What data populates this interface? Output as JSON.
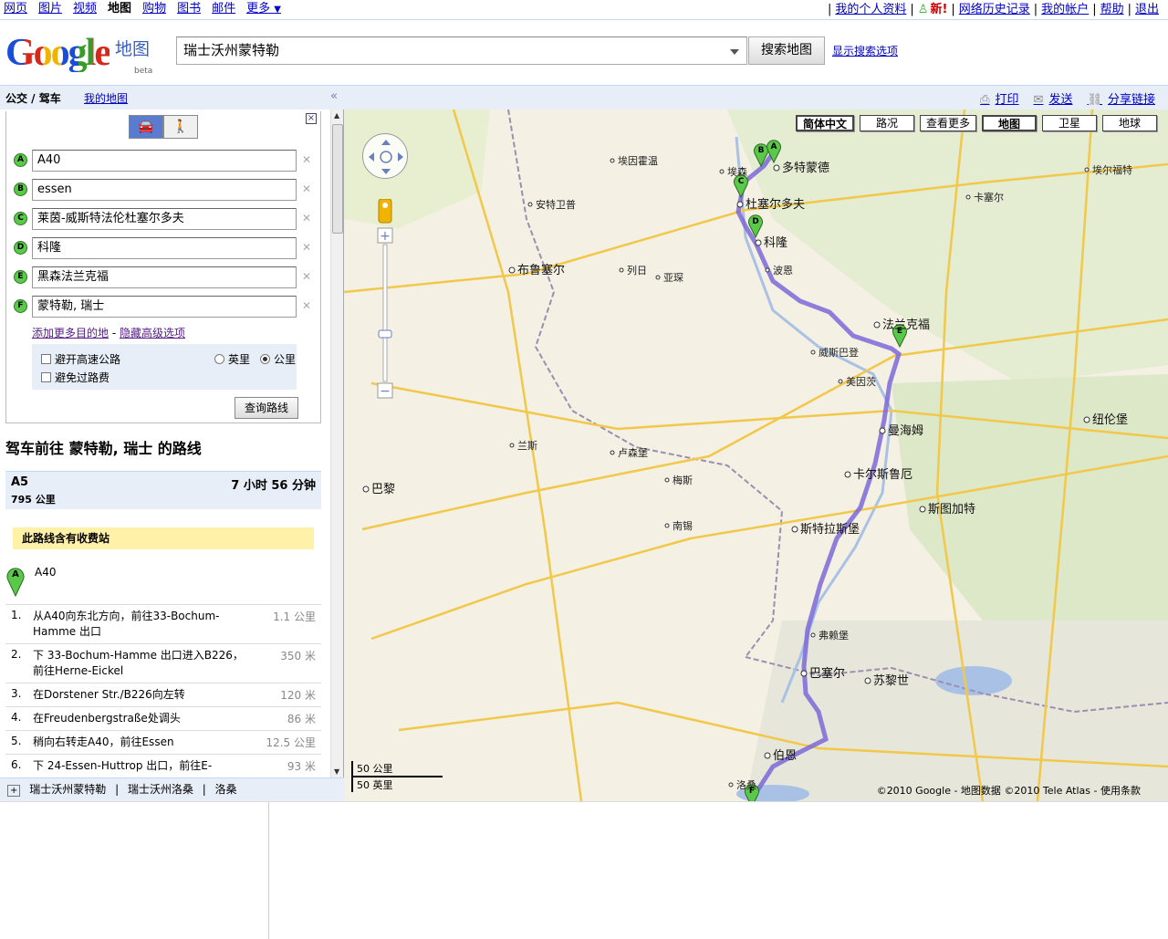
{
  "topnav": {
    "items": [
      "网页",
      "图片",
      "视频",
      "地图",
      "购物",
      "图书",
      "邮件",
      "更多"
    ],
    "current": "地图",
    "more_arrow": "▼",
    "right": {
      "profile": "我的个人资料",
      "new_badge": "新!",
      "history": "网络历史记录",
      "account": "我的帐户",
      "help": "帮助",
      "signout": "退出"
    }
  },
  "header": {
    "logo_google": "Google",
    "logo_maps": "地图",
    "logo_beta": "beta",
    "search_value": "瑞士沃州蒙特勒",
    "search_button": "搜索地图",
    "show_options": "显示搜索选项"
  },
  "toolbar": {
    "tab_directions": "公交 / 驾车",
    "tab_mymaps": "我的地图",
    "collapse": "«",
    "print": "打印",
    "send": "发送",
    "share": "分享链接"
  },
  "directions": {
    "waypoints": [
      {
        "marker": "A",
        "value": "A40"
      },
      {
        "marker": "B",
        "value": "essen"
      },
      {
        "marker": "C",
        "value": "莱茵-威斯特法伦杜塞尔多夫"
      },
      {
        "marker": "D",
        "value": "科隆"
      },
      {
        "marker": "E",
        "value": "黑森法兰克福"
      },
      {
        "marker": "F",
        "value": "蒙特勒, 瑞士"
      }
    ],
    "add_destination": "添加更多目的地",
    "hide_options": "隐藏高级选项",
    "avoid_highways": "避开高速公路",
    "avoid_tolls": "避免过路费",
    "unit_miles": "英里",
    "unit_km": "公里",
    "query_button": "查询路线",
    "route_title": "驾车前往 蒙特勒, 瑞士 的路线",
    "summary_road": "A5",
    "summary_distance": "795 公里",
    "summary_time": "7 小时 56 分钟",
    "toll_notice": "此路线含有收费站",
    "start_label": "A40",
    "steps": [
      {
        "n": "1.",
        "text": "从A40向东北方向，前往33-Bochum-Hamme 出口",
        "dist": "1.1 公里"
      },
      {
        "n": "2.",
        "text": "下 33-Bochum-Hamme 出口进入B226，前往Herne-Eickel",
        "dist": "350 米"
      },
      {
        "n": "3.",
        "text": "在Dorstener Str./B226向左转",
        "dist": "120 米"
      },
      {
        "n": "4.",
        "text": "在Freudenbergstraße处调头",
        "dist": "86 米"
      },
      {
        "n": "5.",
        "text": "稍向右转走A40，前往Essen",
        "dist": "12.5 公里"
      },
      {
        "n": "6.",
        "text": "下 24-Essen-Huttrop 出口，前往E-",
        "dist": "93 米"
      }
    ]
  },
  "bottombar": {
    "links": [
      "瑞士沃州蒙特勒",
      "瑞士沃州洛桑",
      "洛桑"
    ],
    "sep": "|"
  },
  "map": {
    "types": [
      "简体中文",
      "路况",
      "查看更多",
      "地图",
      "卫星",
      "地球"
    ],
    "active_type": "地图",
    "scale_km": "50 公里",
    "scale_mi": "50 英里",
    "copyright": "©2010 Google - 地图数据 ©2010 Tele Atlas - 使用条款",
    "route_color": "#6a5acd",
    "cities": [
      {
        "name": "多特蒙德",
        "big": true
      },
      {
        "name": "杜塞尔多夫",
        "big": true
      },
      {
        "name": "科隆",
        "big": true
      },
      {
        "name": "波恩",
        "big": false
      },
      {
        "name": "法兰克福",
        "big": true
      },
      {
        "name": "曼海姆",
        "big": true
      },
      {
        "name": "卡尔斯鲁厄",
        "big": true
      },
      {
        "name": "斯特拉斯堡",
        "big": true
      },
      {
        "name": "巴塞尔",
        "big": true
      },
      {
        "name": "伯恩",
        "big": true
      },
      {
        "name": "苏黎世",
        "big": true
      },
      {
        "name": "斯图加特",
        "big": true
      },
      {
        "name": "纽伦堡",
        "big": true
      },
      {
        "name": "巴黎",
        "big": true
      },
      {
        "name": "布鲁塞尔",
        "big": true
      },
      {
        "name": "卢森堡",
        "big": false
      },
      {
        "name": "埃因霍温",
        "big": false
      },
      {
        "name": "安特卫普",
        "big": false
      },
      {
        "name": "威斯巴登",
        "big": false
      },
      {
        "name": "美因茨",
        "big": false
      },
      {
        "name": "弗赖堡",
        "big": false
      },
      {
        "name": "洛桑",
        "big": false
      },
      {
        "name": "埃森",
        "big": false
      },
      {
        "name": "卡塞尔",
        "big": false
      },
      {
        "name": "埃尔福特",
        "big": false
      },
      {
        "name": "兰斯",
        "big": false
      },
      {
        "name": "梅斯",
        "big": false
      },
      {
        "name": "南锡",
        "big": false
      },
      {
        "name": "列日",
        "big": false
      },
      {
        "name": "亚琛",
        "big": false
      }
    ]
  }
}
